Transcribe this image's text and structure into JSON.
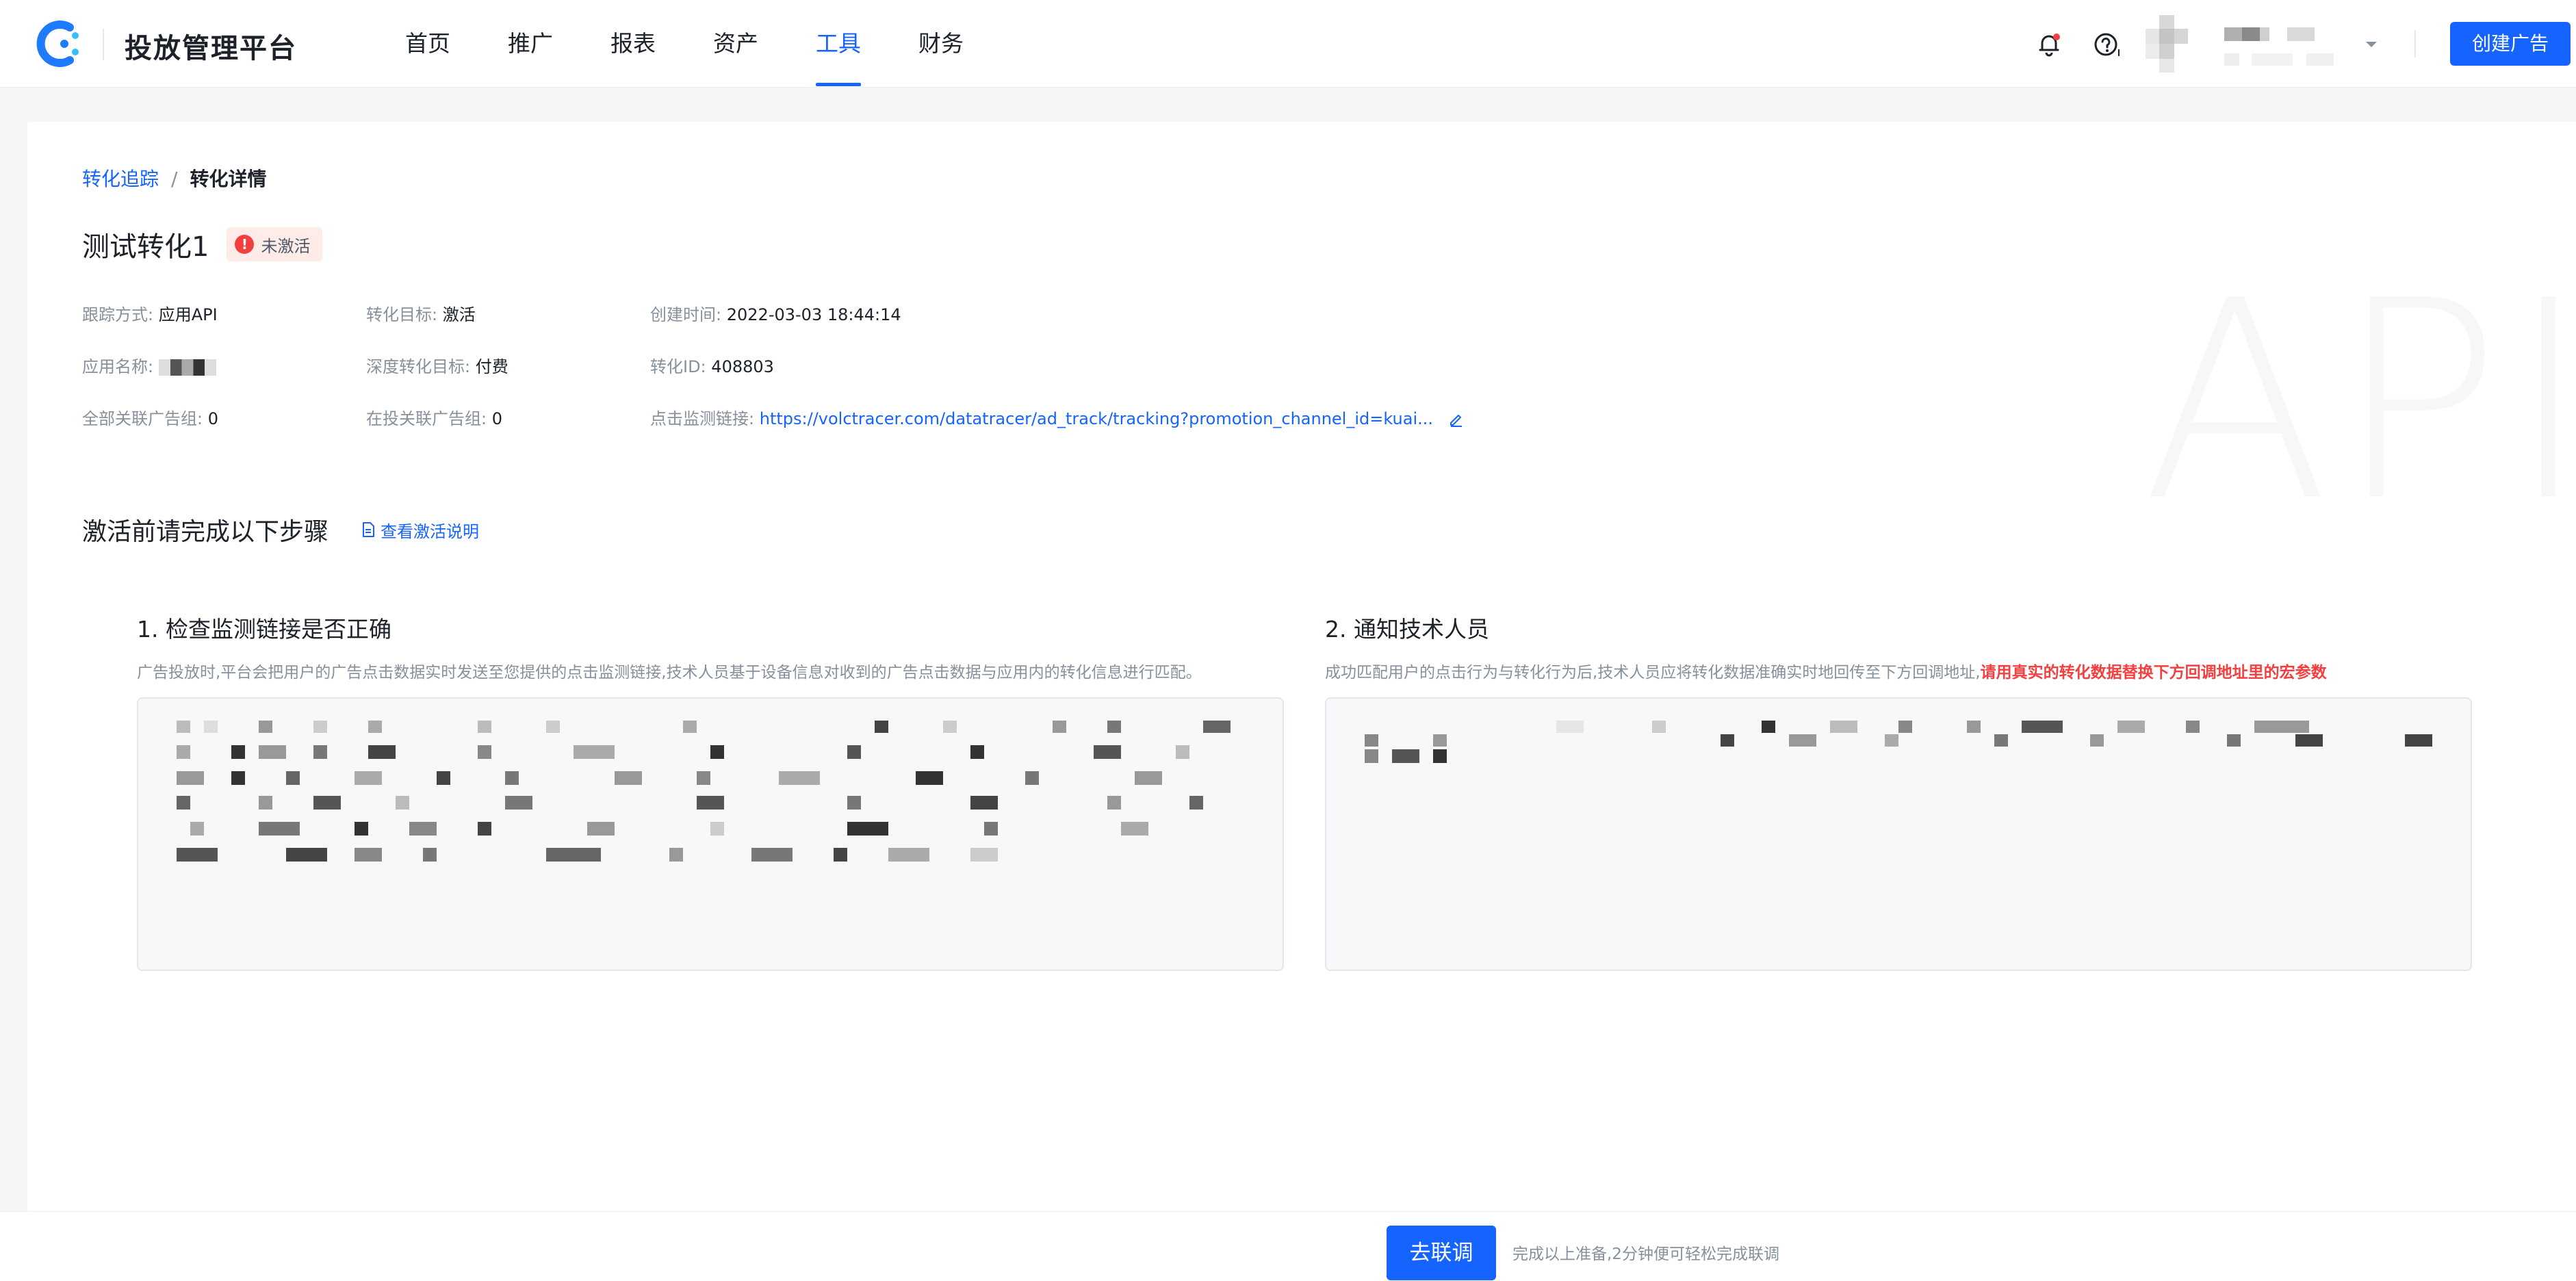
{
  "header": {
    "app_title": "投放管理平台",
    "nav": [
      "首页",
      "推广",
      "报表",
      "资产",
      "工具",
      "财务"
    ],
    "active_nav": "工具",
    "create_button": "创建广告"
  },
  "breadcrumb": {
    "parent": "转化追踪",
    "separator": "/",
    "current": "转化详情"
  },
  "conversion": {
    "name": "测试转化1",
    "status": "未激活",
    "info": {
      "track_method_label": "跟踪方式:",
      "track_method_value": "应用API",
      "goal_label": "转化目标:",
      "goal_value": "激活",
      "created_label": "创建时间:",
      "created_value": "2022-03-03 18:44:14",
      "app_name_label": "应用名称:",
      "deep_goal_label": "深度转化目标:",
      "deep_goal_value": "付费",
      "conv_id_label": "转化ID:",
      "conv_id_value": "408803",
      "all_groups_label": "全部关联广告组:",
      "all_groups_value": "0",
      "active_groups_label": "在投关联广告组:",
      "active_groups_value": "0",
      "click_link_label": "点击监测链接:",
      "click_link_value": "https://volctracer.com/datatracer/ad_track/tracking?promotion_channel_id=kuai..."
    },
    "watermark": "API"
  },
  "steps": {
    "heading": "激活前请完成以下步骤",
    "doc_link": "查看激活说明",
    "step1": {
      "title": "1. 检查监测链接是否正确",
      "desc": "广告投放时,平台会把用户的广告点击数据实时发送至您提供的点击监测链接,技术人员基于设备信息对收到的广告点击数据与应用内的转化信息进行匹配。"
    },
    "step2": {
      "title": "2. 通知技术人员",
      "desc": "成功匹配用户的点击行为与转化行为后,技术人员应将转化数据准确实时地回传至下方回调地址,",
      "warn": "请用真实的转化数据替换下方回调地址里的宏参数"
    }
  },
  "footer": {
    "joint_button": "去联调",
    "hint": "完成以上准备,2分钟便可轻松完成联调"
  }
}
